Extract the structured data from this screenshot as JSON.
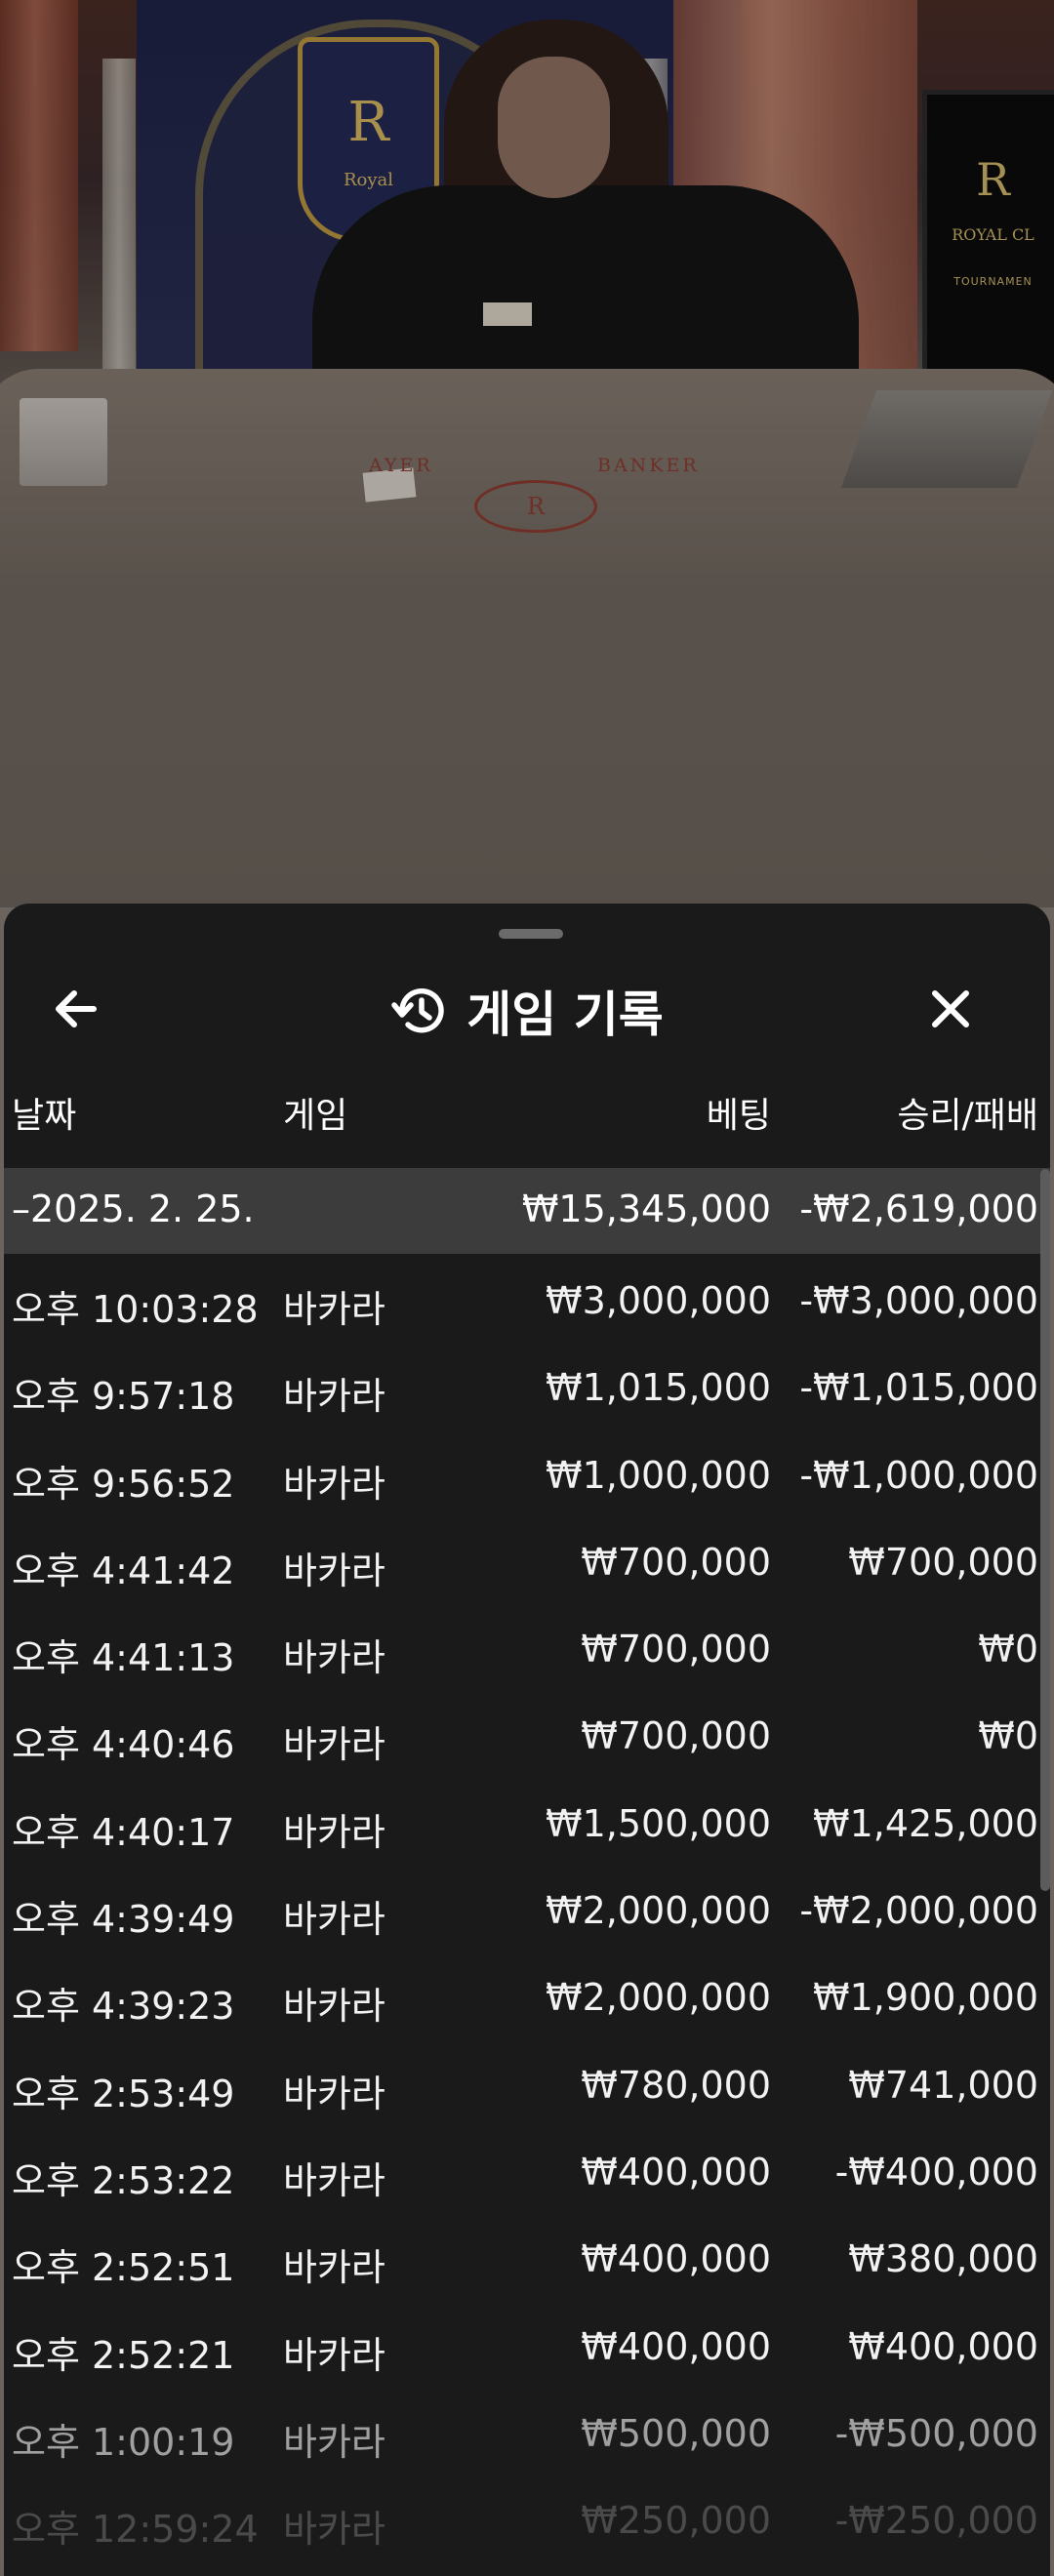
{
  "stream": {
    "shield_letter": "R",
    "shield_text": "Royal",
    "monitor_letter": "R",
    "monitor_line1": "ROYAL CL",
    "monitor_line2": "TOURNAMEN",
    "felt_player": "AYER",
    "felt_banker": "BANKER",
    "felt_logo_letter": "R"
  },
  "sheet": {
    "title": "게임 기록",
    "columns": {
      "date": "날짜",
      "game": "게임",
      "bet": "베팅",
      "result": "승리/패배"
    },
    "summary": {
      "date": "–2025. 2. 25.",
      "bet": "₩15,345,000",
      "result": "-₩2,619,000"
    },
    "rows": [
      {
        "time": "오후 10:03:28",
        "game": "바카라",
        "bet": "₩3,000,000",
        "result": "-₩3,000,000"
      },
      {
        "time": "오후 9:57:18",
        "game": "바카라",
        "bet": "₩1,015,000",
        "result": "-₩1,015,000"
      },
      {
        "time": "오후 9:56:52",
        "game": "바카라",
        "bet": "₩1,000,000",
        "result": "-₩1,000,000"
      },
      {
        "time": "오후 4:41:42",
        "game": "바카라",
        "bet": "₩700,000",
        "result": "₩700,000"
      },
      {
        "time": "오후 4:41:13",
        "game": "바카라",
        "bet": "₩700,000",
        "result": "₩0"
      },
      {
        "time": "오후 4:40:46",
        "game": "바카라",
        "bet": "₩700,000",
        "result": "₩0"
      },
      {
        "time": "오후 4:40:17",
        "game": "바카라",
        "bet": "₩1,500,000",
        "result": "₩1,425,000"
      },
      {
        "time": "오후 4:39:49",
        "game": "바카라",
        "bet": "₩2,000,000",
        "result": "-₩2,000,000"
      },
      {
        "time": "오후 4:39:23",
        "game": "바카라",
        "bet": "₩2,000,000",
        "result": "₩1,900,000"
      },
      {
        "time": "오후 2:53:49",
        "game": "바카라",
        "bet": "₩780,000",
        "result": "₩741,000"
      },
      {
        "time": "오후 2:53:22",
        "game": "바카라",
        "bet": "₩400,000",
        "result": "-₩400,000"
      },
      {
        "time": "오후 2:52:51",
        "game": "바카라",
        "bet": "₩400,000",
        "result": "₩380,000"
      },
      {
        "time": "오후 2:52:21",
        "game": "바카라",
        "bet": "₩400,000",
        "result": "₩400,000"
      },
      {
        "time": "오후 1:00:19",
        "game": "바카라",
        "bet": "₩500,000",
        "result": "-₩500,000"
      },
      {
        "time": "오후 12:59:24",
        "game": "바카라",
        "bet": "₩250,000",
        "result": "-₩250,000"
      }
    ]
  },
  "icons": {
    "back": "arrow-left-icon",
    "close": "close-icon",
    "history": "history-icon"
  }
}
